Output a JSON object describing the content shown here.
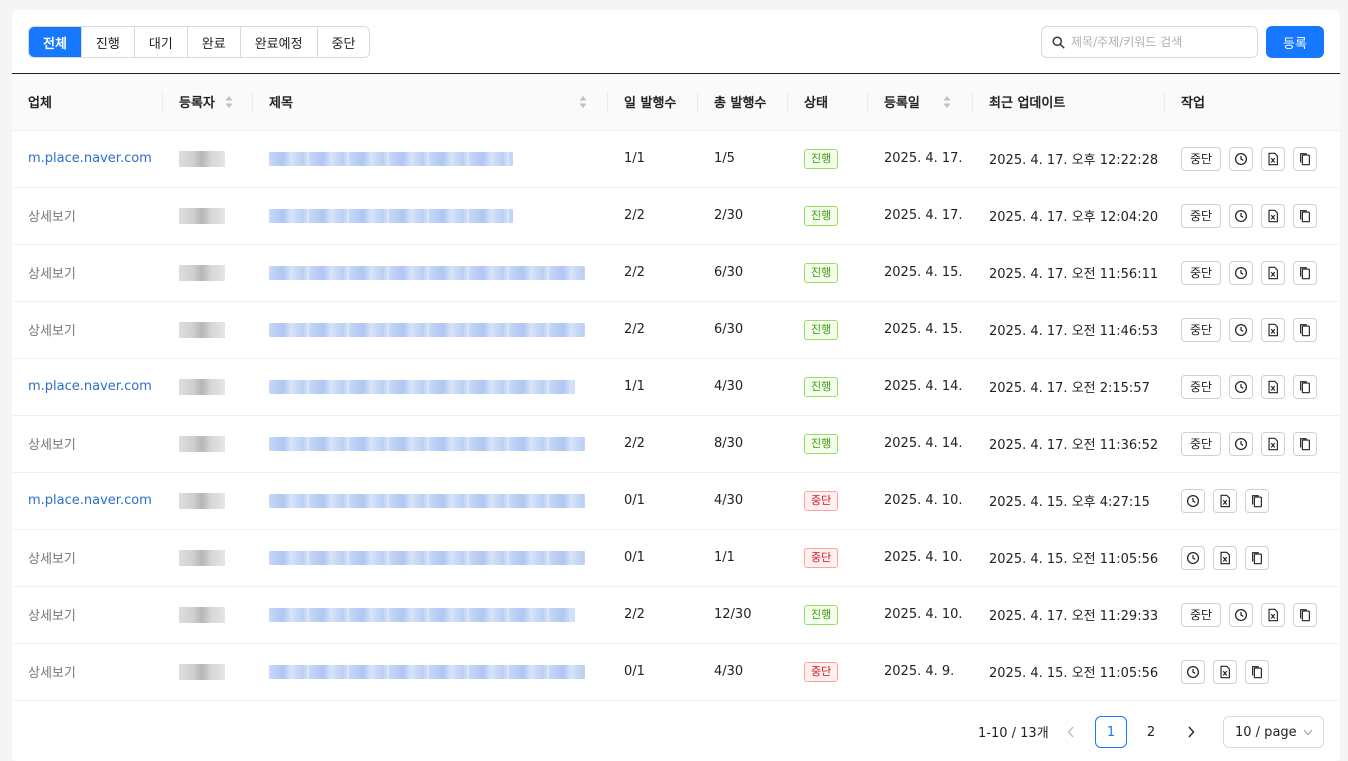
{
  "tabs": [
    {
      "label": "전체",
      "active": true
    },
    {
      "label": "진행",
      "active": false
    },
    {
      "label": "대기",
      "active": false
    },
    {
      "label": "완료",
      "active": false
    },
    {
      "label": "완료예정",
      "active": false
    },
    {
      "label": "중단",
      "active": false
    }
  ],
  "search": {
    "placeholder": "제목/주제/키워드 검색",
    "value": ""
  },
  "register_label": "등록",
  "columns": {
    "company": "업체",
    "registrant": "등록자",
    "title": "제목",
    "daily": "일 발행수",
    "total": "총 발행수",
    "status": "상태",
    "date": "등록일",
    "updated": "최근 업데이트",
    "actions": "작업"
  },
  "stop_label": "중단",
  "rows": [
    {
      "company": "m.place.naver.com",
      "company_link": true,
      "title_w": 244,
      "daily": "1/1",
      "total": "1/5",
      "status": "진행",
      "status_type": "go",
      "date": "2025. 4. 17.",
      "updated": "2025. 4. 17. 오후 12:22:28",
      "can_stop": true
    },
    {
      "company": "상세보기",
      "company_link": false,
      "title_w": 244,
      "daily": "2/2",
      "total": "2/30",
      "status": "진행",
      "status_type": "go",
      "date": "2025. 4. 17.",
      "updated": "2025. 4. 17. 오후 12:04:20",
      "can_stop": true
    },
    {
      "company": "상세보기",
      "company_link": false,
      "title_w": 316,
      "daily": "2/2",
      "total": "6/30",
      "status": "진행",
      "status_type": "go",
      "date": "2025. 4. 15.",
      "updated": "2025. 4. 17. 오전 11:56:11",
      "can_stop": true
    },
    {
      "company": "상세보기",
      "company_link": false,
      "title_w": 316,
      "daily": "2/2",
      "total": "6/30",
      "status": "진행",
      "status_type": "go",
      "date": "2025. 4. 15.",
      "updated": "2025. 4. 17. 오전 11:46:53",
      "can_stop": true
    },
    {
      "company": "m.place.naver.com",
      "company_link": true,
      "title_w": 306,
      "daily": "1/1",
      "total": "4/30",
      "status": "진행",
      "status_type": "go",
      "date": "2025. 4. 14.",
      "updated": "2025. 4. 17. 오전 2:15:57",
      "can_stop": true
    },
    {
      "company": "상세보기",
      "company_link": false,
      "title_w": 316,
      "daily": "2/2",
      "total": "8/30",
      "status": "진행",
      "status_type": "go",
      "date": "2025. 4. 14.",
      "updated": "2025. 4. 17. 오전 11:36:52",
      "can_stop": true
    },
    {
      "company": "m.place.naver.com",
      "company_link": true,
      "title_w": 316,
      "daily": "0/1",
      "total": "4/30",
      "status": "중단",
      "status_type": "stop",
      "date": "2025. 4. 10.",
      "updated": "2025. 4. 15. 오후 4:27:15",
      "can_stop": false
    },
    {
      "company": "상세보기",
      "company_link": false,
      "title_w": 316,
      "daily": "0/1",
      "total": "1/1",
      "status": "중단",
      "status_type": "stop",
      "date": "2025. 4. 10.",
      "updated": "2025. 4. 15. 오전 11:05:56",
      "can_stop": false
    },
    {
      "company": "상세보기",
      "company_link": false,
      "title_w": 306,
      "daily": "2/2",
      "total": "12/30",
      "status": "진행",
      "status_type": "go",
      "date": "2025. 4. 10.",
      "updated": "2025. 4. 17. 오전 11:29:33",
      "can_stop": true
    },
    {
      "company": "상세보기",
      "company_link": false,
      "title_w": 316,
      "daily": "0/1",
      "total": "4/30",
      "status": "중단",
      "status_type": "stop",
      "date": "2025. 4. 9.",
      "updated": "2025. 4. 15. 오전 11:05:56",
      "can_stop": false
    }
  ],
  "pagination": {
    "total_text": "1-10 / 13개",
    "pages": [
      "1",
      "2"
    ],
    "current": "1",
    "page_size": "10 / page"
  },
  "colors": {
    "accent": "#1677ff",
    "link": "#2a6fce",
    "running": "#389e0d",
    "stopped": "#cf1322"
  }
}
